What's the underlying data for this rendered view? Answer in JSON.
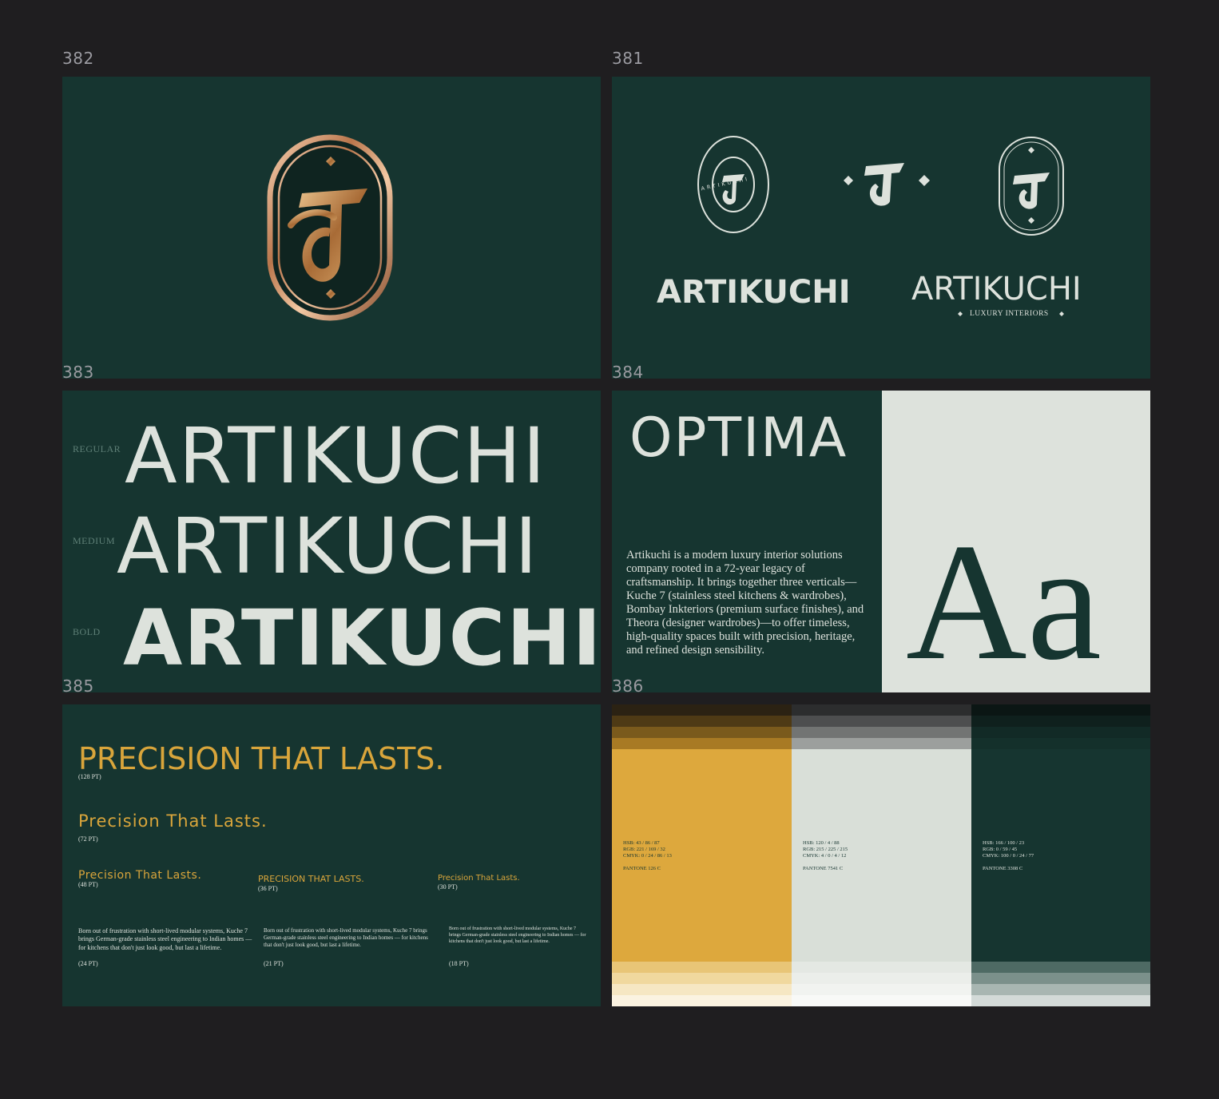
{
  "frames": {
    "f382": "382",
    "f381": "381",
    "f383": "383",
    "f384": "384",
    "f385": "385",
    "f386": "386"
  },
  "logos": {
    "seal_ring_text": "ARTIKUCHI",
    "wordmark_bold": "ARTIKUCHI",
    "wordmark_light": "ARTIKUCHI",
    "tagline": "LUXURY INTERIORS"
  },
  "weights": [
    {
      "label": "REGULAR",
      "word": "ARTIKUCHI"
    },
    {
      "label": "MEDIUM",
      "word": "ARTIKUCHI"
    },
    {
      "label": "BOLD",
      "word": "ARTIKUCHI"
    }
  ],
  "typeface": {
    "name": "OPTIMA",
    "specimen": "Aa",
    "description": "Artikuchi is a modern luxury interior solutions company rooted in a 72-year legacy of craftsmanship. It brings together three verticals—Kuche 7 (stainless steel kitchens & wardrobes), Bombay Inkteriors (premium surface finishes), and Theora (designer wardrobes)—to offer timeless, high-quality spaces built with precision, heritage, and refined design sensibility."
  },
  "hierarchy": {
    "h128": {
      "text": "PRECISION THAT LASTS.",
      "size": "(128 PT)"
    },
    "h72": {
      "text": "Precision That Lasts.",
      "size": "(72 PT)"
    },
    "h48": {
      "text": "Precision That Lasts.",
      "size": "(48 PT)"
    },
    "h36": {
      "text": "PRECISION THAT LASTS.",
      "size": "(36 PT)"
    },
    "h30": {
      "text": "Precision That Lasts.",
      "size": "(30 PT)"
    },
    "b24": {
      "text": "Born out of frustration with short-lived modular systems, Kuche 7 brings German-grade stainless steel engineering to Indian homes — for kitchens that don't just look good, but last a lifetime.",
      "size": "(24 PT)"
    },
    "b21": {
      "text": "Born out of frustration with short-lived modular systems, Kuche 7 brings German-grade stainless steel engineering to Indian homes — for kitchens that don't just look good, but last a lifetime.",
      "size": "(21 PT)"
    },
    "b18": {
      "text": "Born out of frustration with short-lived modular systems, Kuche 7 brings German-grade stainless steel engineering to Indian homes — for kitchens that don't just look good, but last a lifetime.",
      "size": "(18 PT)"
    }
  },
  "palette": [
    {
      "hex": "#dda83d",
      "hsb": "HSB: 43 / 86 / 87",
      "rgb": "RGB: 221 / 169 / 32",
      "cmyk": "CMYK: 0 / 24 / 86 / 13",
      "pantone": "PANTONE 126 C",
      "top": [
        "#2b2213",
        "#4e3a15",
        "#7a5a1c",
        "#a87a24"
      ],
      "bottom": [
        "#e8c577",
        "#f0d89e",
        "#f6e7c3",
        "#fbf3e1"
      ]
    },
    {
      "hex": "#d9dfd8",
      "hsb": "HSB: 120 / 4 / 88",
      "rgb": "RGB: 215 / 225 / 215",
      "cmyk": "CMYK: 4 / 0 / 4 / 12",
      "pantone": "PANTONE 7541 C",
      "top": [
        "#2c2d2e",
        "#4d4e4f",
        "#727473",
        "#9c9f9d"
      ],
      "bottom": [
        "#e4e8e3",
        "#ebeeea",
        "#f1f3f0",
        "#f8f9f7"
      ]
    },
    {
      "hex": "#163530",
      "hsb": "HSB: 166 / 100 / 23",
      "rgb": "RGB: 0 / 59 / 45",
      "cmyk": "CMYK: 100 / 0 / 24 / 77",
      "pantone": "PANTONE 3308 C",
      "top": [
        "#0b1614",
        "#0f201d",
        "#122a26",
        "#14302b"
      ],
      "bottom": [
        "#4e6a64",
        "#7b908b",
        "#a8b6b2",
        "#d3dad8"
      ]
    }
  ]
}
